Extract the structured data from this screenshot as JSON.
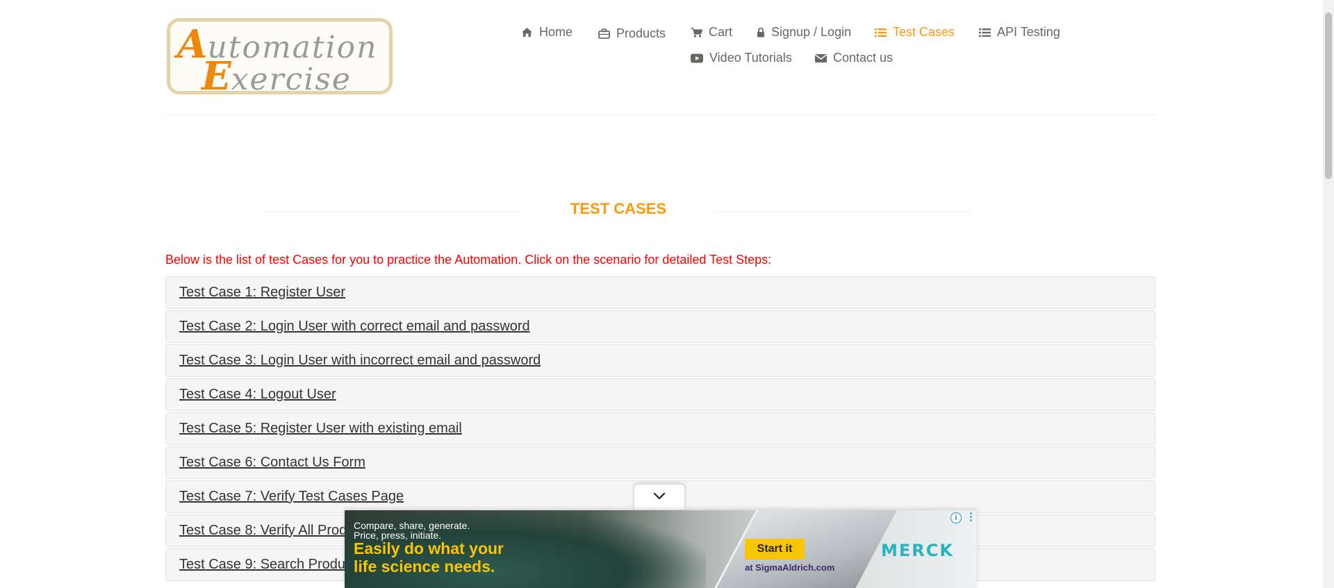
{
  "logo": {
    "line1_cap": "A",
    "line1_rest": "utomation",
    "line2_cap": "E",
    "line2_rest": "xercise"
  },
  "nav": {
    "items": [
      {
        "label": "Home",
        "icon": "home-icon"
      },
      {
        "label": "Products",
        "icon": "briefcase-icon"
      },
      {
        "label": "Cart",
        "icon": "cart-icon"
      },
      {
        "label": "Signup / Login",
        "icon": "lock-icon"
      },
      {
        "label": "Test Cases",
        "icon": "list-icon",
        "active": true
      },
      {
        "label": "API Testing",
        "icon": "list-icon"
      },
      {
        "label": "Video Tutorials",
        "icon": "youtube-icon"
      },
      {
        "label": "Contact us",
        "icon": "envelope-icon"
      }
    ]
  },
  "page": {
    "title": "TEST CASES",
    "intro": "Below is the list of test Cases for you to practice the Automation. Click on the scenario for detailed Test Steps:"
  },
  "test_cases": [
    "Test Case 1: Register User",
    "Test Case 2: Login User with correct email and password",
    "Test Case 3: Login User with incorrect email and password",
    "Test Case 4: Logout User",
    "Test Case 5: Register User with existing email",
    "Test Case 6: Contact Us Form",
    "Test Case 7: Verify Test Cases Page",
    "Test Case 8: Verify All Products and product detail page",
    "Test Case 9: Search Product"
  ],
  "ad": {
    "small_line1": "Compare, share, generate.",
    "small_line2": "Price, press, initiate.",
    "headline_line1": "Easily do what your",
    "headline_line2": "life science needs.",
    "cta": "Start it",
    "site": "at SigmaAldrich.com",
    "brand": "MERCK",
    "info_glyph": "i",
    "more_glyph": "⋮"
  },
  "colors": {
    "accent": "#fe980f",
    "intro_text": "#fe0000",
    "link": "#333333",
    "nav_text": "#696763"
  }
}
